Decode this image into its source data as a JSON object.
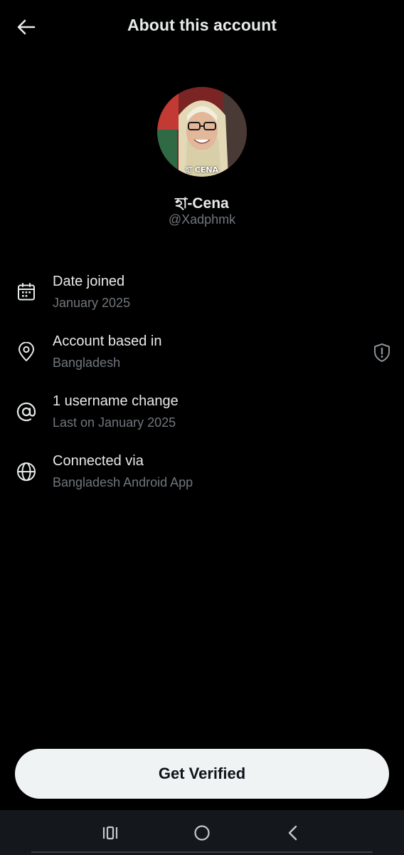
{
  "header": {
    "title": "About this account",
    "back_icon": "arrow-left-icon"
  },
  "profile": {
    "avatar_caption": "হা CENA",
    "display_name": "হা-Cena",
    "handle": "@Xadphmk"
  },
  "rows": [
    {
      "icon": "calendar-icon",
      "title": "Date joined",
      "subtitle": "January 2025"
    },
    {
      "icon": "location-pin-icon",
      "title": "Account based in",
      "subtitle": "Bangladesh",
      "trailing_icon": "shield-alert-icon"
    },
    {
      "icon": "at-sign-icon",
      "title": "1 username change",
      "subtitle": "Last on January 2025"
    },
    {
      "icon": "globe-icon",
      "title": "Connected via",
      "subtitle": "Bangladesh Android App"
    }
  ],
  "cta": {
    "label": "Get Verified"
  },
  "nav": {
    "items": [
      "recent-apps-icon",
      "home-icon",
      "back-icon"
    ]
  },
  "colors": {
    "background": "#000000",
    "primary_text": "#e7e9ea",
    "secondary_text": "#71767b",
    "button_bg": "#eff3f4",
    "button_text": "#0f1419",
    "nav_bg": "#14171b"
  }
}
